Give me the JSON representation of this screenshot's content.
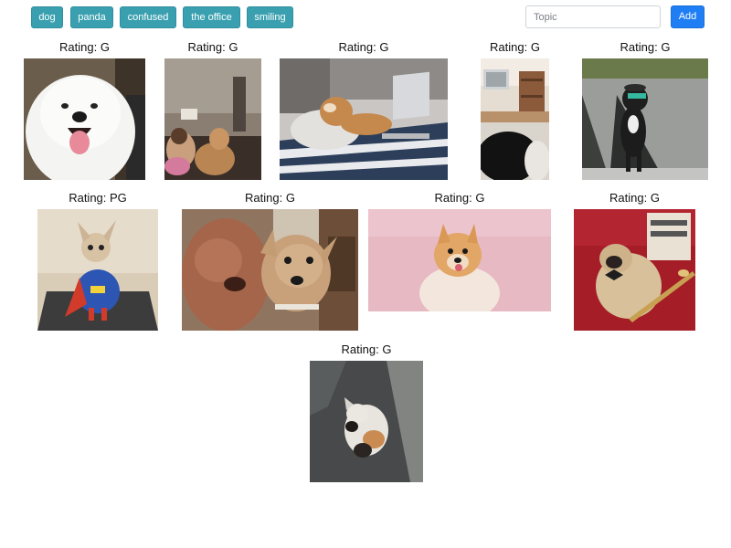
{
  "toolbar": {
    "topics": [
      "dog",
      "panda",
      "confused",
      "the office",
      "smiling"
    ],
    "input_placeholder": "Topic",
    "input_value": "",
    "add_label": "Add"
  },
  "gifs": [
    {
      "rating_label": "Rating: G",
      "scene": "white-samoyed-smiling"
    },
    {
      "rating_label": "Rating: G",
      "scene": "dog-on-couch-with-people"
    },
    {
      "rating_label": "Rating: G",
      "scene": "shiba-in-bed-with-laptop"
    },
    {
      "rating_label": "Rating: G",
      "scene": "black-cat-in-living-room"
    },
    {
      "rating_label": "Rating: G",
      "scene": "dog-in-sunglasses-standing"
    },
    {
      "rating_label": "Rating: PG",
      "scene": "chihuahua-superman-treadmill"
    },
    {
      "rating_label": "Rating: G",
      "scene": "two-dogs-close-up"
    },
    {
      "rating_label": "Rating: G",
      "scene": "pomeranian-pink-background"
    },
    {
      "rating_label": "Rating: G",
      "scene": "pug-with-bow-tie"
    },
    {
      "rating_label": "Rating: G",
      "scene": "cat-walking-in-rain"
    }
  ],
  "colors": {
    "topic_button": "#3aa0b0",
    "add_button": "#1f7ef4"
  }
}
